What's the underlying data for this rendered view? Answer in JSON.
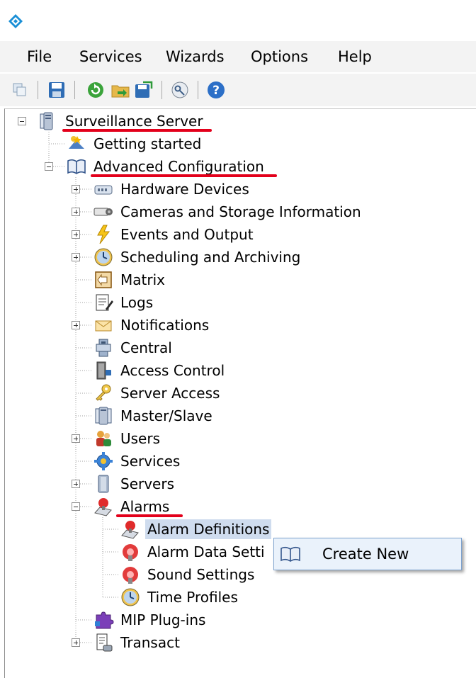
{
  "menu": {
    "file": "File",
    "services": "Services",
    "wizards": "Wizards",
    "options": "Options",
    "help": "Help"
  },
  "colors": {
    "annotation": "#e3001b",
    "selection": "#cfdcee",
    "context_menu_bg": "#eaf2fb"
  },
  "tree": {
    "root": "Surveillance Server",
    "getting_started": "Getting started",
    "advanced": "Advanced Configuration",
    "hardware": "Hardware Devices",
    "cameras": "Cameras and Storage Information",
    "events": "Events and Output",
    "scheduling": "Scheduling and Archiving",
    "matrix": "Matrix",
    "logs": "Logs",
    "notifications": "Notifications",
    "central": "Central",
    "access_control": "Access Control",
    "server_access": "Server Access",
    "master_slave": "Master/Slave",
    "users": "Users",
    "services": "Services",
    "servers": "Servers",
    "alarms": "Alarms",
    "alarm_definitions": "Alarm Definitions",
    "alarm_data_settings": "Alarm Data Setti",
    "sound_settings": "Sound Settings",
    "time_profiles": "Time Profiles",
    "mip_plugins": "MIP Plug-ins",
    "transact": "Transact"
  },
  "context_menu": {
    "create_new": "Create New"
  }
}
